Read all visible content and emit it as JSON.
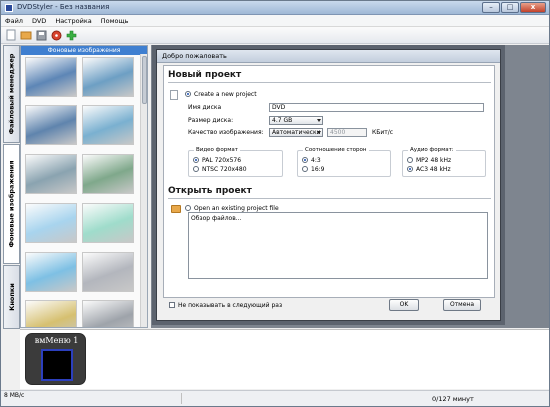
{
  "window": {
    "title": "DVDStyler - Без названия",
    "controls": {
      "minimize": "–",
      "maximize": "□",
      "close": "x"
    }
  },
  "menu": [
    "Файл",
    "DVD",
    "Настройка",
    "Помощь"
  ],
  "toolbar": [
    "new-icon",
    "open-icon",
    "save-icon",
    "burn-icon",
    "add-icon"
  ],
  "vtabs": [
    "Файловый менеджер",
    "Фоновые изображения",
    "Кнопки"
  ],
  "gallery": {
    "header": "Фоновые изображения",
    "thumbs": [
      {
        "color": "#5d86b6"
      },
      {
        "color": "#6d9fc4"
      },
      {
        "color": "#5f84ad"
      },
      {
        "color": "#7ab0d0"
      },
      {
        "color": "#8aa3b0"
      },
      {
        "color": "#7fa88b"
      },
      {
        "color": "#a8d4ee"
      },
      {
        "color": "#9fdccb"
      },
      {
        "color": "#7ec0e4"
      },
      {
        "color": "#b3b6bd"
      },
      {
        "color": "#d6c070"
      },
      {
        "color": "#9ea3aa"
      }
    ]
  },
  "bottom": {
    "menu_label": "вмМеню 1"
  },
  "status": {
    "size": "8 MB/c",
    "duration": "0/127 минут"
  },
  "dialog": {
    "title": "Добро пожаловать",
    "new_project": {
      "heading": "Новый проект",
      "create_label": "Create a new project",
      "disc_name_label": "Имя диска",
      "disc_name_value": "DVD",
      "disc_size_label": "Размер диска:",
      "disc_size_value": "4.7 GB",
      "quality_label": "Качество изображения:",
      "quality_value": "Автоматически",
      "bitrate_value": "4500",
      "bitrate_unit": "КБит/с",
      "video_format": {
        "title": "Видео формат",
        "options": [
          "PAL 720x576",
          "NTSC 720x480"
        ],
        "selected": 0
      },
      "aspect": {
        "title": "Соотношение сторон",
        "options": [
          "4:3",
          "16:9"
        ],
        "selected": 0
      },
      "audio": {
        "title": "Аудио формат:",
        "options": [
          "MP2 48 kHz",
          "AC3 48 kHz"
        ],
        "selected": 1
      }
    },
    "open_project": {
      "heading": "Открыть проект",
      "open_label": "Open an existing project file",
      "browse_label": "Обзор файлов..."
    },
    "dont_show": "Не показывать в следующий раз",
    "ok": "OK",
    "cancel": "Отмена"
  }
}
